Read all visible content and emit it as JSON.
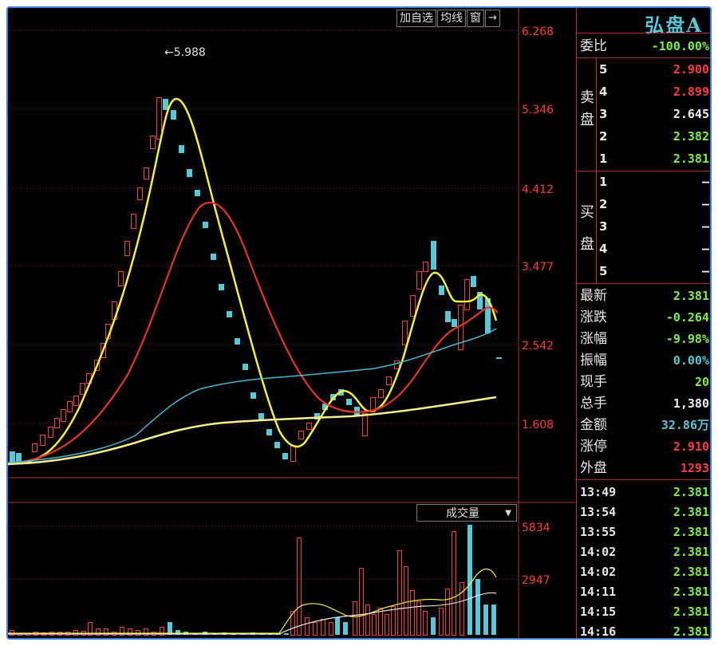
{
  "stock": {
    "name": "弘盘A"
  },
  "toolbar": {
    "add_watch": "加自选",
    "ma_lines": "均线",
    "window": "窗",
    "exit": "→"
  },
  "price_axis": {
    "labels": [
      "6.268",
      "5.346",
      "4.412",
      "3.477",
      "2.542",
      "1.608"
    ]
  },
  "high_marker": {
    "text": "←5.988"
  },
  "volume": {
    "indicator_label": "成交量",
    "axis_labels": [
      "5834",
      "2947"
    ]
  },
  "colors": {
    "up": "#ff3b3b",
    "down": "#56c8d8",
    "ma_yellow": "#f5f03c",
    "ma_red": "#e8322a",
    "ma_cyan": "#46b8d0",
    "ma_cream": "#f5f08a",
    "grid": "#8a2020",
    "frame": "#3f7fe0"
  },
  "order_book": {
    "ratio": {
      "label": "委比",
      "value": "-100.00%"
    },
    "sell_label": "卖盘",
    "buy_label": "买盘",
    "sell": [
      {
        "level": "5",
        "price": "2.900"
      },
      {
        "level": "4",
        "price": "2.899"
      },
      {
        "level": "3",
        "price": "2.645"
      },
      {
        "level": "2",
        "price": "2.382"
      },
      {
        "level": "1",
        "price": "2.381"
      }
    ],
    "buy": [
      {
        "level": "1",
        "price": "–"
      },
      {
        "level": "2",
        "price": "–"
      },
      {
        "level": "3",
        "price": "–"
      },
      {
        "level": "4",
        "price": "–"
      },
      {
        "level": "5",
        "price": "–"
      }
    ]
  },
  "quote": [
    {
      "label": "最新",
      "value": "2.381"
    },
    {
      "label": "涨跌",
      "value": "-0.264"
    },
    {
      "label": "涨幅",
      "value": "-9.98%"
    },
    {
      "label": "振幅",
      "value": "0.00%"
    },
    {
      "label": "现手",
      "value": "20"
    },
    {
      "label": "总手",
      "value": "1,380"
    },
    {
      "label": "金额",
      "value": "32.86万"
    },
    {
      "label": "涨停",
      "value": "2.910"
    },
    {
      "label": "外盘",
      "value": "1293"
    }
  ],
  "ticks": [
    {
      "time": "13:49",
      "price": "2.381"
    },
    {
      "time": "13:54",
      "price": "2.381"
    },
    {
      "time": "13:55",
      "price": "2.381"
    },
    {
      "time": "14:02",
      "price": "2.381"
    },
    {
      "time": "14:02",
      "price": "2.381"
    },
    {
      "time": "14:11",
      "price": "2.381"
    },
    {
      "time": "14:15",
      "price": "2.381"
    },
    {
      "time": "14:16",
      "price": "2.381"
    }
  ]
}
